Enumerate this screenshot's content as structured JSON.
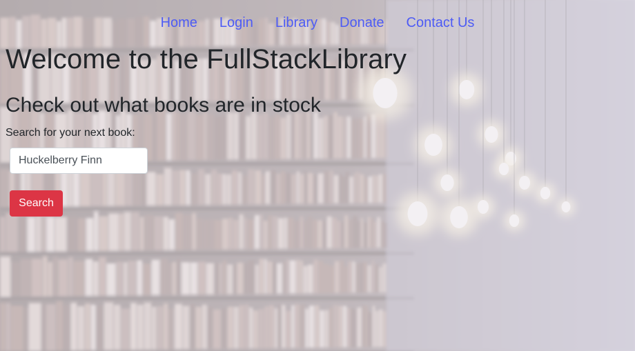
{
  "nav": {
    "items": [
      {
        "label": "Home"
      },
      {
        "label": "Login"
      },
      {
        "label": "Library"
      },
      {
        "label": "Donate"
      },
      {
        "label": "Contact Us"
      }
    ]
  },
  "hero": {
    "title": "Welcome to the FullStackLibrary",
    "subtitle": "Check out what books are in stock"
  },
  "search": {
    "label": "Search for your next book:",
    "value": "Huckelberry Finn",
    "button_label": "Search"
  },
  "colors": {
    "link": "#4d5bf5",
    "button": "#dc3545",
    "text": "#212529"
  },
  "background": {
    "icon": "library-bookshelf-photo"
  }
}
